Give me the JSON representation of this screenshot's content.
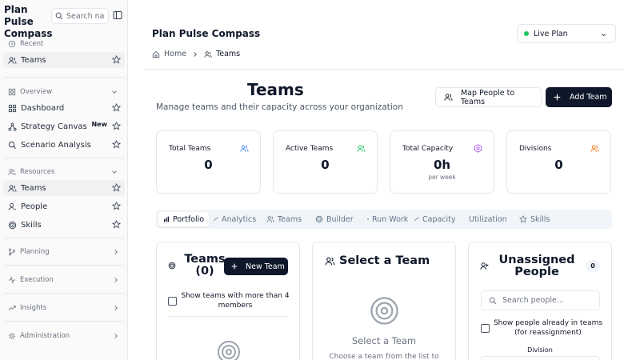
{
  "sidebar": {
    "brand": "Plan Pulse Compass",
    "search_placeholder": "Search na",
    "recent_label": "Recent",
    "recent_items": [
      {
        "label": "Teams"
      }
    ],
    "overview_label": "Overview",
    "overview_items": [
      {
        "label": "Dashboard"
      },
      {
        "label": "Strategy Canvas",
        "badge": "New"
      },
      {
        "label": "Scenario Analysis"
      }
    ],
    "resources_label": "Resources",
    "resources_items": [
      {
        "label": "Teams"
      },
      {
        "label": "People"
      },
      {
        "label": "Skills"
      }
    ],
    "groups": [
      {
        "label": "Planning"
      },
      {
        "label": "Execution"
      },
      {
        "label": "Insights"
      },
      {
        "label": "Administration"
      }
    ]
  },
  "header": {
    "title": "Plan Pulse Compass",
    "plan_select": "Live Plan",
    "breadcrumb": {
      "home": "Home",
      "current": "Teams"
    }
  },
  "page": {
    "title": "Teams",
    "subtitle": "Manage teams and their capacity across your organization",
    "map_button": "Map People to Teams",
    "add_button": "Add Team"
  },
  "stats": [
    {
      "label": "Total Teams",
      "value": "0",
      "icon": "users-icon",
      "color": "#3b82f6"
    },
    {
      "label": "Active Teams",
      "value": "0",
      "icon": "users-icon",
      "color": "#22c55e"
    },
    {
      "label": "Total Capacity",
      "value": "0h",
      "sub": "per week",
      "icon": "gear-icon",
      "color": "#a855f7"
    },
    {
      "label": "Divisions",
      "value": "0",
      "icon": "users-icon",
      "color": "#f97316"
    }
  ],
  "tabs": [
    {
      "label": "Portfolio",
      "active": true
    },
    {
      "label": "Analytics"
    },
    {
      "label": "Teams"
    },
    {
      "label": "Builder"
    },
    {
      "label": "Run Work"
    },
    {
      "label": "Capacity"
    },
    {
      "label": "Utilization"
    },
    {
      "label": "Skills"
    }
  ],
  "teams_panel": {
    "title": "Teams (0)",
    "new_button": "New Team",
    "checkbox_label": "Show teams with more than 4 members"
  },
  "select_panel": {
    "title": "Select a Team",
    "empty_title": "Select a Team",
    "empty_sub": "Choose a team from the list to"
  },
  "unassigned_panel": {
    "title": "Unassigned People",
    "count": "0",
    "search_placeholder": "Search people...",
    "checkbox_label": "Show people already in teams (for reassignment)",
    "division_label": "Division"
  }
}
